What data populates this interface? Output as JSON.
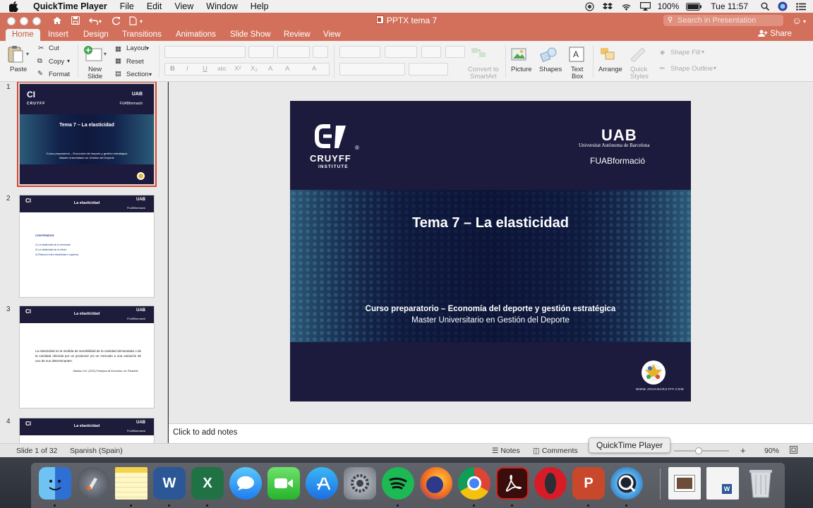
{
  "menubar": {
    "app": "QuickTime Player",
    "items": [
      "File",
      "Edit",
      "View",
      "Window",
      "Help"
    ],
    "battery": "100%",
    "clock": "Tue 11:57"
  },
  "window": {
    "title": "PPTX tema 7",
    "search_placeholder": "Search in Presentation"
  },
  "ribbon": {
    "tabs": [
      "Home",
      "Insert",
      "Design",
      "Transitions",
      "Animations",
      "Slide Show",
      "Review",
      "View"
    ],
    "share": "Share",
    "paste": "Paste",
    "cut": "Cut",
    "copy": "Copy",
    "format": "Format",
    "new_slide_1": "New",
    "new_slide_2": "Slide",
    "layout": "Layout",
    "reset": "Reset",
    "section": "Section",
    "convert_1": "Convert to",
    "convert_2": "SmartArt",
    "picture": "Picture",
    "shapes": "Shapes",
    "textbox_1": "Text",
    "textbox_2": "Box",
    "arrange": "Arrange",
    "quick_1": "Quick",
    "quick_2": "Styles",
    "shape_fill": "Shape Fill",
    "shape_outline": "Shape Outline"
  },
  "thumbnails": {
    "numbers": [
      "1",
      "2",
      "3",
      "4"
    ],
    "t1_title": "Tema 7 – La elasticidad",
    "t1_sub1": "Curso preparatorio – Economía del deporte y gestión estratégica",
    "t1_sub2": "Master Universitario en Gestión del Deporte",
    "t2_title": "La elasticidad",
    "t2_heading": "CONTENIDOS",
    "t2_items": [
      "1) La elasticidad de la demanda",
      "2) La elasticidad de la oferta",
      "3) Relación entre elasticidad e ingresos"
    ],
    "t3_title": "La elasticidad",
    "t3_body": "La elasticidad es la medida de sensibilidad de la cantidad demandada o de la cantidad ofrecida por un productor y/o un mercado a una variación de uno de sus determinantes.",
    "t3_cite": "Mankiw, N.G. (2012) Principios de Economía, ed. Paraninfo",
    "t4_title": "La elasticidad"
  },
  "slide": {
    "cruyff_1": "CRUYFF",
    "cruyff_2": "INSTITUTE",
    "uab_logo": "UAB",
    "uab_name": "Universitat Autònoma de Barcelona",
    "fuab": "FUABformació",
    "title": "Tema 7 – La elasticidad",
    "subtitle_1": "Curso preparatorio – Economía del deporte y gestión estratégica",
    "subtitle_2": "Master Universitario en Gestión del Deporte",
    "website": "WWW.JOHANCRUYFF.COM"
  },
  "notes": {
    "placeholder": "Click to add notes"
  },
  "status": {
    "slide_count": "Slide 1 of 32",
    "language": "Spanish (Spain)",
    "notes_btn": "Notes",
    "comments_btn": "Comments",
    "zoom": "90%"
  },
  "tooltip": "QuickTime Player",
  "colors": {
    "ribbon": "#d2705b",
    "slide_bg": "#1c1b3d"
  },
  "dock": [
    "finder-icon",
    "launchpad-icon",
    "notes-icon",
    "word-icon",
    "excel-icon",
    "messages-icon",
    "facetime-icon",
    "app-store-icon",
    "system-preferences-icon",
    "spotify-icon",
    "firefox-icon",
    "chrome-icon",
    "acrobat-icon",
    "opera-icon",
    "powerpoint-icon",
    "quicktime-icon",
    "preview-icon",
    "document-icon",
    "trash-icon"
  ]
}
